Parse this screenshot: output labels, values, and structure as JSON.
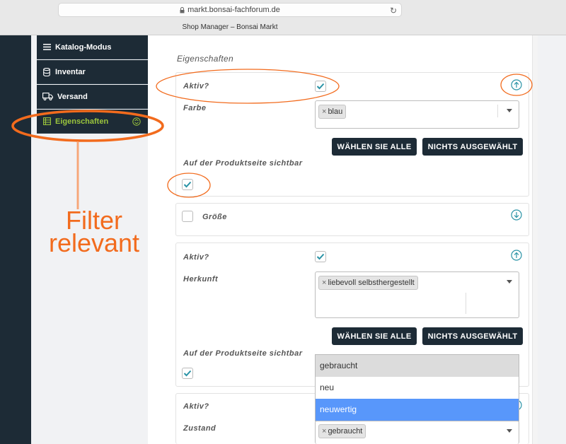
{
  "browser": {
    "url": "markt.bonsai-fachforum.de",
    "tab_title": "Shop Manager – Bonsai Markt"
  },
  "sidebar": {
    "items": [
      {
        "label": "Katalog-Modus",
        "icon": "menu-icon"
      },
      {
        "label": "Inventar",
        "icon": "database-icon"
      },
      {
        "label": "Versand",
        "icon": "truck-icon"
      },
      {
        "label": "Eigenschaften",
        "icon": "list-icon",
        "active": true
      }
    ]
  },
  "main": {
    "section_title": "Eigenschaften",
    "card1": {
      "active_label": "Aktiv?",
      "field_label": "Farbe",
      "tag": "blau",
      "btn_select_all": "WÄHLEN SIE ALLE",
      "btn_none": "NICHTS AUSGEWÄHLT",
      "visible_label": "Auf der Produktseite sichtbar"
    },
    "card2": {
      "label": "Größe"
    },
    "card3": {
      "active_label": "Aktiv?",
      "field_label": "Herkunft",
      "tag": "liebevoll selbsthergestellt",
      "btn_select_all": "WÄHLEN SIE ALLE",
      "btn_none": "NICHTS AUSGEWÄHLT",
      "visible_label": "Auf der Produktseite sichtbar"
    },
    "card4": {
      "active_label": "Aktiv?",
      "field_label": "Zustand",
      "tag": "gebraucht"
    },
    "dropdown_options": [
      "gebraucht",
      "neu",
      "neuwertig"
    ]
  },
  "annotation": {
    "line1": "Filter",
    "line2": "relevant",
    "color": "#f26b1d"
  },
  "colors": {
    "sidebar_bg": "#1d2b36",
    "accent_green": "#9bc53d",
    "check_teal": "#2a93a6",
    "highlight_blue": "#5897fb"
  }
}
